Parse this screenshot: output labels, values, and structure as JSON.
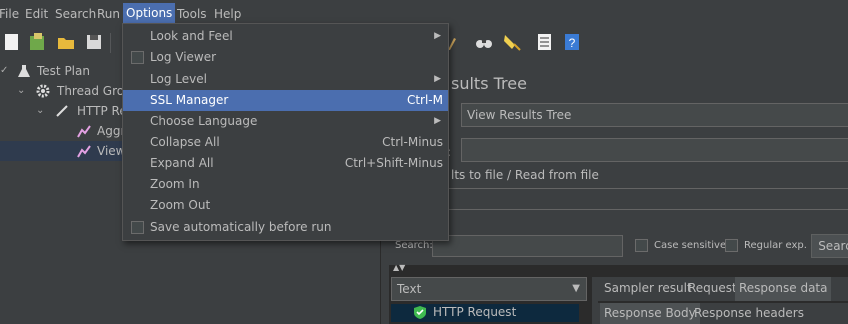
{
  "menubar": {
    "items": [
      {
        "label": "File"
      },
      {
        "label": "Edit"
      },
      {
        "label": "Search"
      },
      {
        "label": "Run"
      },
      {
        "label": "Options"
      },
      {
        "label": "Tools"
      },
      {
        "label": "Help"
      }
    ]
  },
  "options_menu": {
    "items": [
      {
        "label": "Look and Feel",
        "submenu": true
      },
      {
        "label": "Log Viewer",
        "checkbox": true
      },
      {
        "label": "Log Level",
        "submenu": true
      },
      {
        "label": "SSL Manager",
        "accelerator": "Ctrl-M",
        "selected": true
      },
      {
        "label": "Choose Language",
        "submenu": true
      },
      {
        "label": "Collapse All",
        "accelerator": "Ctrl-Minus"
      },
      {
        "label": "Expand All",
        "accelerator": "Ctrl+Shift-Minus"
      },
      {
        "label": "Zoom In"
      },
      {
        "label": "Zoom Out"
      },
      {
        "label": "Save automatically before run",
        "checkbox": true
      }
    ]
  },
  "tree": {
    "items": [
      {
        "label": "Test Plan",
        "icon": "flask-icon"
      },
      {
        "label": "Thread Grou",
        "icon": "gear-icon"
      },
      {
        "label": "HTTP Re",
        "icon": "pipette-icon"
      },
      {
        "label": "Aggr",
        "icon": "chart-icon"
      },
      {
        "label": "View",
        "icon": "chart-icon",
        "selected": true
      }
    ]
  },
  "panel": {
    "title_fragment": "sults Tree",
    "name_value": "View Results Tree",
    "comment_fragment": ":",
    "file_group_fragment": "lts to file / Read from file",
    "search_label": "Search:",
    "case_sensitive_label": "Case sensitive",
    "regex_label": "Regular exp.",
    "search_button": "Searc",
    "renderer_value": "Text",
    "result_item": "HTTP Request",
    "tabs": [
      "Sampler result",
      "Request",
      "Response data"
    ],
    "subtabs": [
      "Response Body",
      "Response headers"
    ]
  },
  "colors": {
    "background": "#3c3f41",
    "highlight": "#4b6eaf",
    "text": "#bbbbbb",
    "success": "#3fb950"
  }
}
